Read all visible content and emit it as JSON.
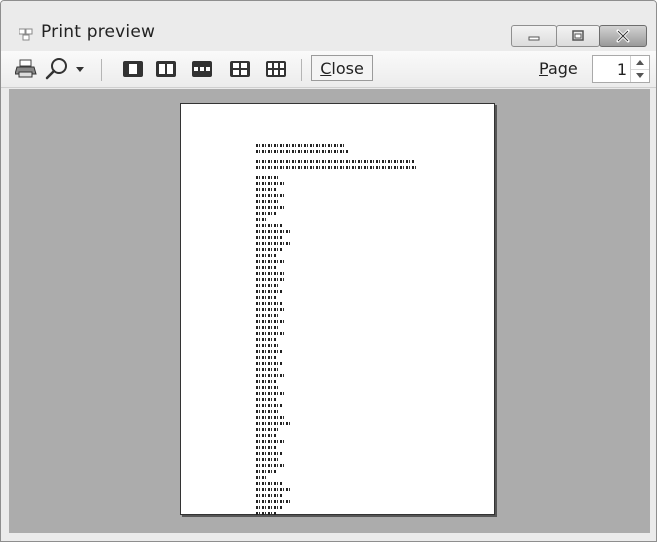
{
  "window": {
    "title": "Print preview",
    "controls": {
      "minimize_icon": "minimize-icon",
      "maximize_icon": "maximize-icon",
      "close_icon": "close-icon"
    }
  },
  "toolbar": {
    "items": [
      {
        "name": "print-icon"
      },
      {
        "name": "zoom-icon"
      },
      {
        "name": "zoom-dropdown-icon"
      },
      {
        "name": "one-page-icon"
      },
      {
        "name": "two-pages-icon"
      },
      {
        "name": "three-pages-icon"
      },
      {
        "name": "four-pages-icon"
      },
      {
        "name": "six-pages-icon"
      }
    ],
    "close_label_underlined": "C",
    "close_label_rest": "lose",
    "page_label_underlined": "P",
    "page_label_rest": "age",
    "page_value": "1"
  },
  "colors": {
    "preview_background": "#acacac",
    "window_chrome": "#ebebeb"
  }
}
